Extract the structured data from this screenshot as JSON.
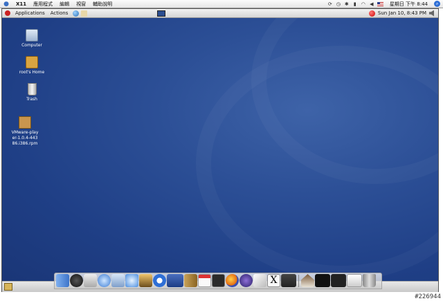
{
  "mac_menubar": {
    "app_name": "X11",
    "menus": [
      "應用程式",
      "編輯",
      "視窗",
      "輔助說明"
    ],
    "clock": "星期日 下午 8:44",
    "status_icons": [
      "sync-icon",
      "clock-icon",
      "bluetooth-icon",
      "battery-icon",
      "wifi-icon",
      "volume-icon",
      "us-flag-icon"
    ]
  },
  "gnome_panel": {
    "applications_label": "Applications",
    "actions_label": "Actions",
    "datetime": "Sun Jan 10,  8:43 PM"
  },
  "desktop_icons": [
    {
      "label": "Computer",
      "icon": "computer-icon"
    },
    {
      "label": "root's Home",
      "icon": "home-folder-icon"
    },
    {
      "label": "Trash",
      "icon": "trash-icon"
    },
    {
      "label": "VMware-player-1.0.4-44386.i386.rpm",
      "icon": "package-icon"
    }
  ],
  "dock_items": [
    "finder",
    "dashboard",
    "apple",
    "safari",
    "preview",
    "itunes",
    "iphoto",
    "sync",
    "calculator",
    "notes",
    "ical",
    "terminal",
    "firefox",
    "network",
    "textedit",
    "x11",
    "window1",
    "|",
    "house",
    "window2",
    "window3",
    "window4",
    "trash"
  ],
  "watermark": "#226944",
  "colors": {
    "desktop": "#24458c",
    "panel": "#e2e2e2"
  }
}
